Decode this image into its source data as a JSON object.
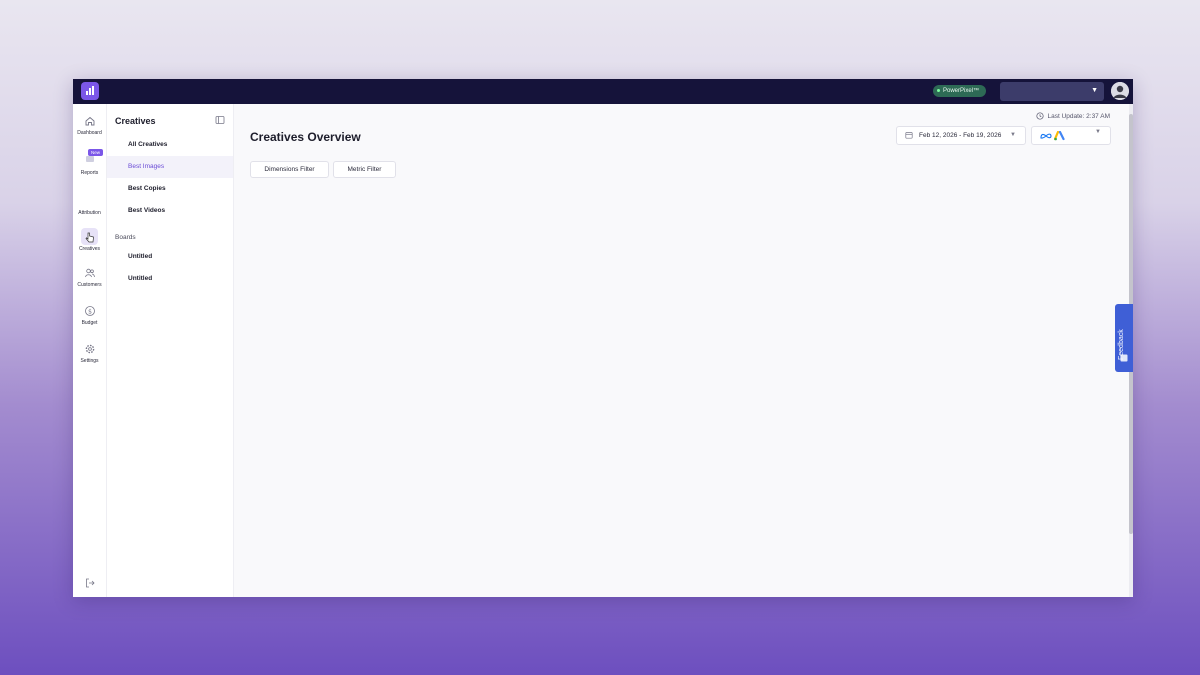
{
  "topbar": {
    "pixel_badge": "PowerPixel™",
    "account_select_value": "",
    "logo_icon": "bar-chart-logo-icon",
    "avatar_icon": "user-avatar-icon"
  },
  "rail": {
    "items": [
      {
        "label": "Dashboard",
        "icon": "home-icon"
      },
      {
        "label": "Reports",
        "icon": "reports-icon",
        "badge": "New"
      },
      {
        "label": "Attribution",
        "icon": "attribution-icon"
      },
      {
        "label": "Creatives",
        "icon": "hand-pointer-icon"
      },
      {
        "label": "Customers",
        "icon": "users-icon"
      },
      {
        "label": "Budget",
        "icon": "dollar-circle-icon"
      },
      {
        "label": "Settings",
        "icon": "gear-icon"
      }
    ],
    "logout_icon": "logout-icon"
  },
  "subnav": {
    "title": "Creatives",
    "items": [
      {
        "label": "All Creatives"
      },
      {
        "label": "Best Images",
        "active": true
      },
      {
        "label": "Best Copies"
      },
      {
        "label": "Best Videos"
      }
    ],
    "boards_label": "Boards",
    "boards": [
      {
        "label": "Untitled"
      },
      {
        "label": "Untitled"
      }
    ]
  },
  "main": {
    "title": "Creatives Overview",
    "last_update": "Last Update: 2:37 AM",
    "date_range": "Feb 12, 2026 - Feb 19, 2026",
    "platforms": [
      "meta-icon",
      "google-ads-icon"
    ],
    "dimensions_filter": "Dimensions Filter",
    "metric_filter": "Metric Filter"
  },
  "feedback": {
    "label": "Feedback"
  },
  "colors": {
    "brand": "#7b57e8",
    "topbar": "#15133a",
    "feedback": "#3f5fd6",
    "active_text": "#6a4bd6"
  }
}
